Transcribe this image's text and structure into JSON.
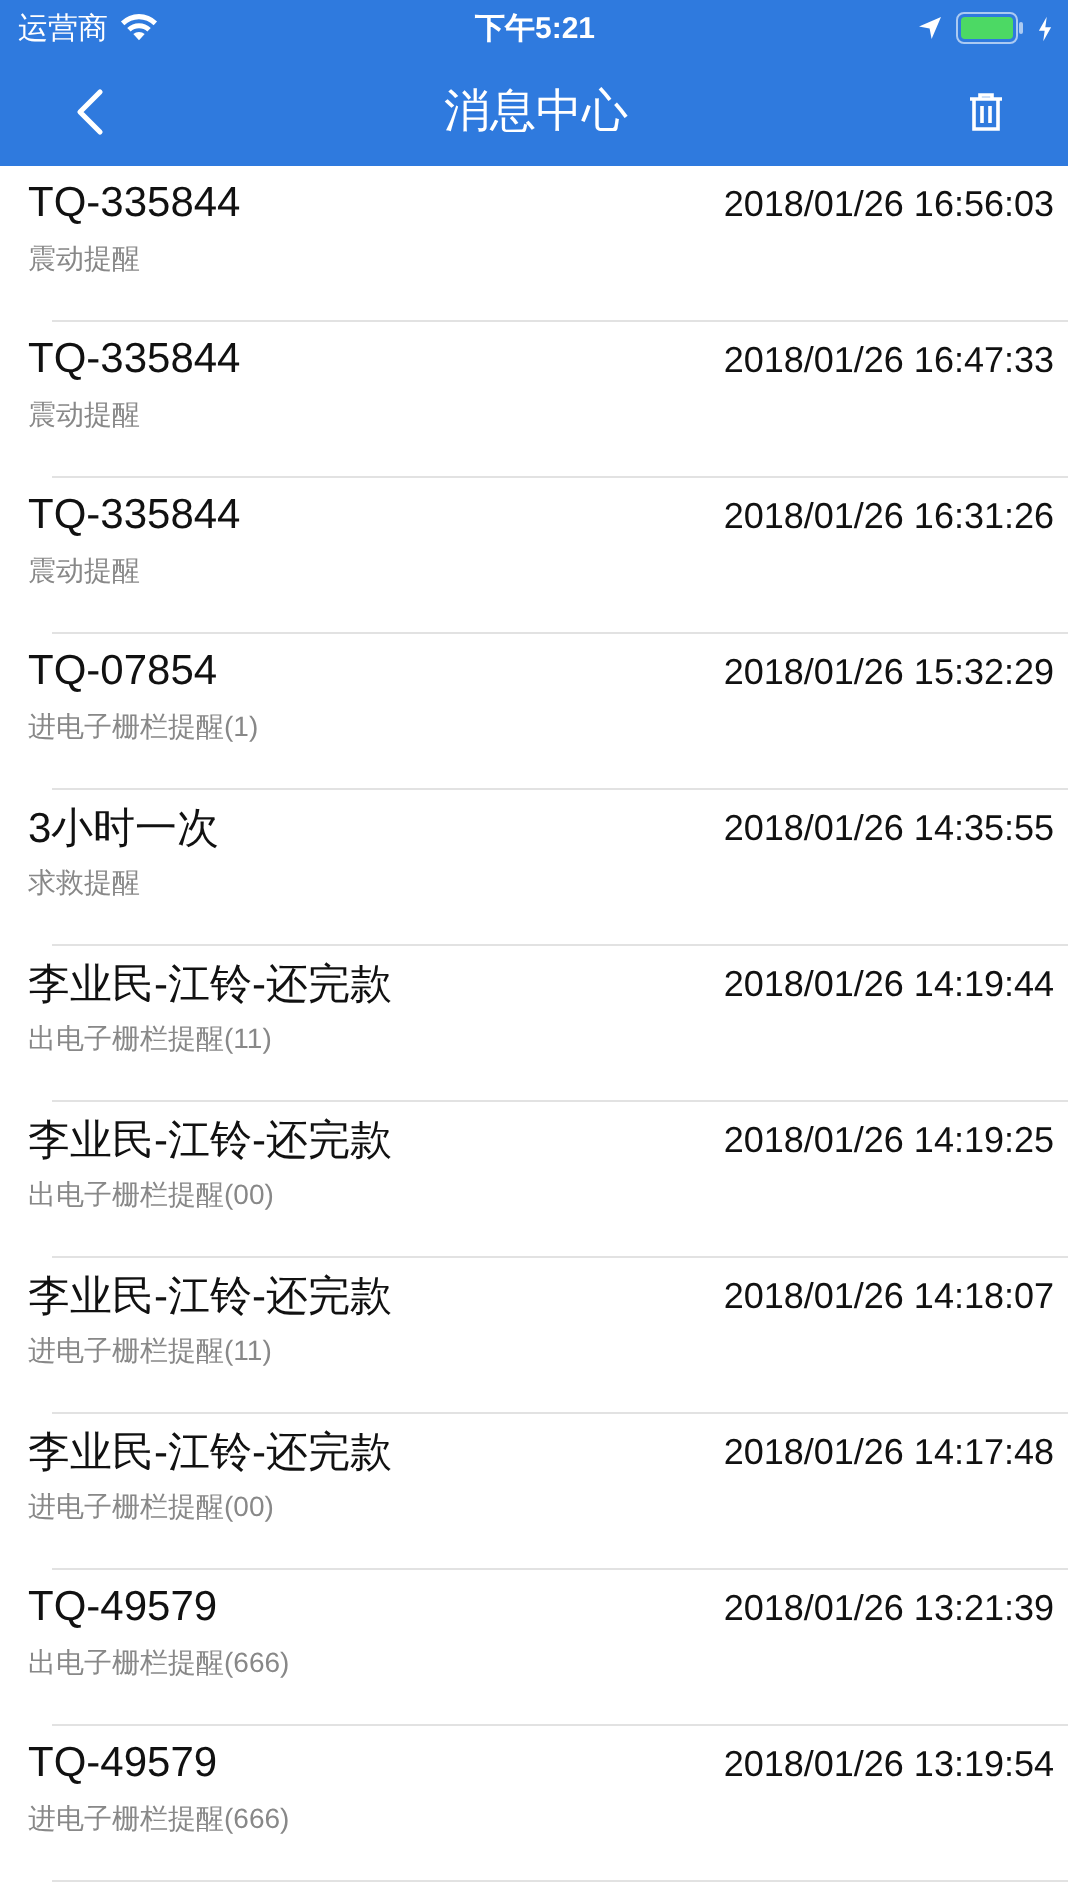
{
  "status_bar": {
    "carrier": "运营商",
    "time": "下午5:21"
  },
  "nav_bar": {
    "title": "消息中心"
  },
  "messages": [
    {
      "title": "TQ-335844",
      "time": "2018/01/26 16:56:03",
      "subtitle": "震动提醒"
    },
    {
      "title": "TQ-335844",
      "time": "2018/01/26 16:47:33",
      "subtitle": "震动提醒"
    },
    {
      "title": "TQ-335844",
      "time": "2018/01/26 16:31:26",
      "subtitle": "震动提醒"
    },
    {
      "title": "TQ-07854",
      "time": "2018/01/26 15:32:29",
      "subtitle": "进电子栅栏提醒(1)"
    },
    {
      "title": "3小时一次",
      "time": "2018/01/26 14:35:55",
      "subtitle": "求救提醒"
    },
    {
      "title": "李业民-江铃-还完款",
      "time": "2018/01/26 14:19:44",
      "subtitle": "出电子栅栏提醒(11)"
    },
    {
      "title": "李业民-江铃-还完款",
      "time": "2018/01/26 14:19:25",
      "subtitle": "出电子栅栏提醒(00)"
    },
    {
      "title": "李业民-江铃-还完款",
      "time": "2018/01/26 14:18:07",
      "subtitle": "进电子栅栏提醒(11)"
    },
    {
      "title": "李业民-江铃-还完款",
      "time": "2018/01/26 14:17:48",
      "subtitle": "进电子栅栏提醒(00)"
    },
    {
      "title": "TQ-49579",
      "time": "2018/01/26 13:21:39",
      "subtitle": "出电子栅栏提醒(666)"
    },
    {
      "title": "TQ-49579",
      "time": "2018/01/26 13:19:54",
      "subtitle": "进电子栅栏提醒(666)"
    }
  ]
}
